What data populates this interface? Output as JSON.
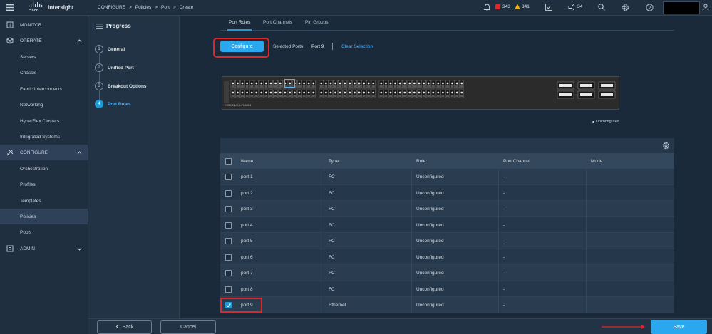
{
  "header": {
    "brand_top": "cisco",
    "brand_name": "Intersight",
    "breadcrumb": [
      "CONFIGURE",
      "Policies",
      "Port",
      "Create"
    ],
    "alerts_critical": "343",
    "alerts_warning": "341",
    "announcements": "34"
  },
  "nav": {
    "items": [
      {
        "label": "MONITOR",
        "section": true
      },
      {
        "label": "OPERATE",
        "section": true
      },
      {
        "label": "Servers"
      },
      {
        "label": "Chassis"
      },
      {
        "label": "Fabric Interconnects"
      },
      {
        "label": "Networking"
      },
      {
        "label": "HyperFlex Clusters"
      },
      {
        "label": "Integrated Systems"
      },
      {
        "label": "CONFIGURE",
        "section": true
      },
      {
        "label": "Orchestration"
      },
      {
        "label": "Profiles"
      },
      {
        "label": "Templates"
      },
      {
        "label": "Policies"
      },
      {
        "label": "Pools"
      },
      {
        "label": "ADMIN",
        "section": true
      }
    ]
  },
  "progress": {
    "title": "Progress",
    "steps": [
      {
        "num": "1",
        "label": "General"
      },
      {
        "num": "2",
        "label": "Unified Port"
      },
      {
        "num": "3",
        "label": "Breakout Options"
      },
      {
        "num": "4",
        "label": "Port Roles"
      }
    ]
  },
  "tabs": [
    "Port Roles",
    "Port Channels",
    "Pin Groups"
  ],
  "toolbar": {
    "configure_label": "Configure",
    "selected_ports_label": "Selected Ports",
    "selected_port": "Port 9",
    "clear_selection": "Clear Selection"
  },
  "switch": {
    "model_label": "CISCO UCS-FI-6454",
    "legend": "Unconfigured"
  },
  "table": {
    "columns": [
      "Name",
      "Type",
      "Role",
      "Port Channel",
      "Mode"
    ],
    "rows": [
      {
        "name": "port 1",
        "type": "FC",
        "role": "Unconfigured",
        "channel": "-",
        "mode": "",
        "checked": false
      },
      {
        "name": "port 2",
        "type": "FC",
        "role": "Unconfigured",
        "channel": "-",
        "mode": "",
        "checked": false
      },
      {
        "name": "port 3",
        "type": "FC",
        "role": "Unconfigured",
        "channel": "-",
        "mode": "",
        "checked": false
      },
      {
        "name": "port 4",
        "type": "FC",
        "role": "Unconfigured",
        "channel": "-",
        "mode": "",
        "checked": false
      },
      {
        "name": "port 5",
        "type": "FC",
        "role": "Unconfigured",
        "channel": "-",
        "mode": "",
        "checked": false
      },
      {
        "name": "port 6",
        "type": "FC",
        "role": "Unconfigured",
        "channel": "-",
        "mode": "",
        "checked": false
      },
      {
        "name": "port 7",
        "type": "FC",
        "role": "Unconfigured",
        "channel": "-",
        "mode": "",
        "checked": false
      },
      {
        "name": "port 8",
        "type": "FC",
        "role": "Unconfigured",
        "channel": "-",
        "mode": "",
        "checked": false
      },
      {
        "name": "port 9",
        "type": "Ethernet",
        "role": "Unconfigured",
        "channel": "-",
        "mode": "",
        "checked": true
      }
    ]
  },
  "footer": {
    "back_label": "Back",
    "cancel_label": "Cancel",
    "save_label": "Save"
  },
  "colors": {
    "accent": "#1e9bd7",
    "highlight": "#e0262b"
  }
}
